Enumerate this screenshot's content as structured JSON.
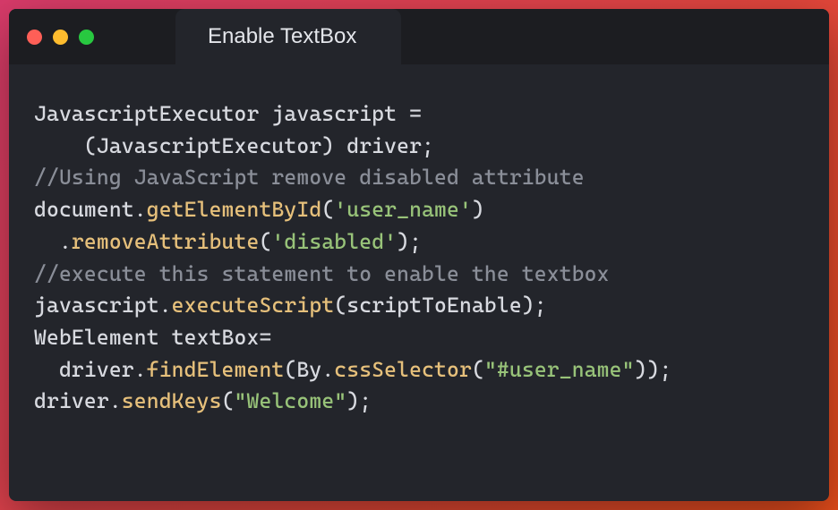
{
  "window": {
    "tab_title": "Enable TextBox"
  },
  "colors": {
    "background_gradient_start": "#d93b6b",
    "background_gradient_end": "#e94e1b",
    "window_bg": "#23252b",
    "titlebar_bg": "#1c1d21",
    "red": "#ff5f57",
    "yellow": "#febc2e",
    "green": "#28c840",
    "text": "#d8dae0",
    "comment": "#8a8e98",
    "method": "#e6c07b",
    "string": "#98c379"
  },
  "code": {
    "l1a": "JavascriptExecutor javascript = ",
    "l2a": "    (JavascriptExecutor) driver;",
    "l3a": "//Using JavaScript remove disabled attribute",
    "l4a": "document.",
    "l4b": "getElementById",
    "l4c": "(",
    "l4d": "'user_name'",
    "l4e": ")",
    "l5a": "  .",
    "l5b": "removeAttribute",
    "l5c": "(",
    "l5d": "'disabled'",
    "l5e": ");",
    "l6a": "//execute this statement to enable the textbox",
    "l7a": "javascript.",
    "l7b": "executeScript",
    "l7c": "(scriptToEnable);",
    "l8a": "WebElement textBox=",
    "l9a": "  driver.",
    "l9b": "findElement",
    "l9c": "(By.",
    "l9d": "cssSelector",
    "l9e": "(",
    "l9f": "\"#user_name\"",
    "l9g": "));",
    "l10a": "driver.",
    "l10b": "sendKeys",
    "l10c": "(",
    "l10d": "\"Welcome\"",
    "l10e": ");"
  }
}
